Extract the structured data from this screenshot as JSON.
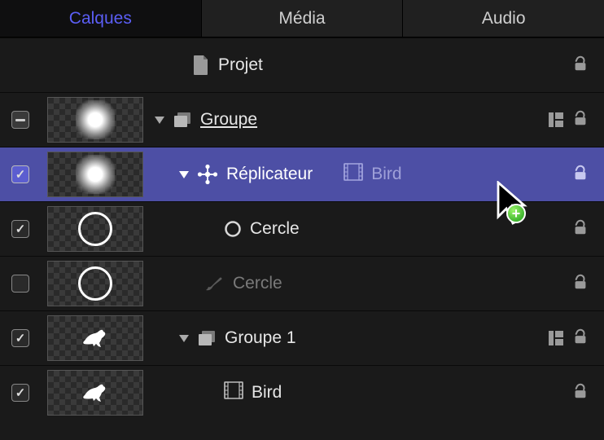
{
  "tabs": {
    "calques": "Calques",
    "media": "Média",
    "audio": "Audio",
    "active": "calques"
  },
  "rows": {
    "projet": {
      "label": "Projet"
    },
    "groupe": {
      "label": "Groupe"
    },
    "replicateur": {
      "label": "Réplicateur",
      "drop_label": "Bird"
    },
    "cercle1": {
      "label": "Cercle"
    },
    "cercle2": {
      "label": "Cercle"
    },
    "groupe1": {
      "label": "Groupe 1"
    },
    "bird": {
      "label": "Bird"
    }
  },
  "cursor": {
    "badge": "+"
  }
}
